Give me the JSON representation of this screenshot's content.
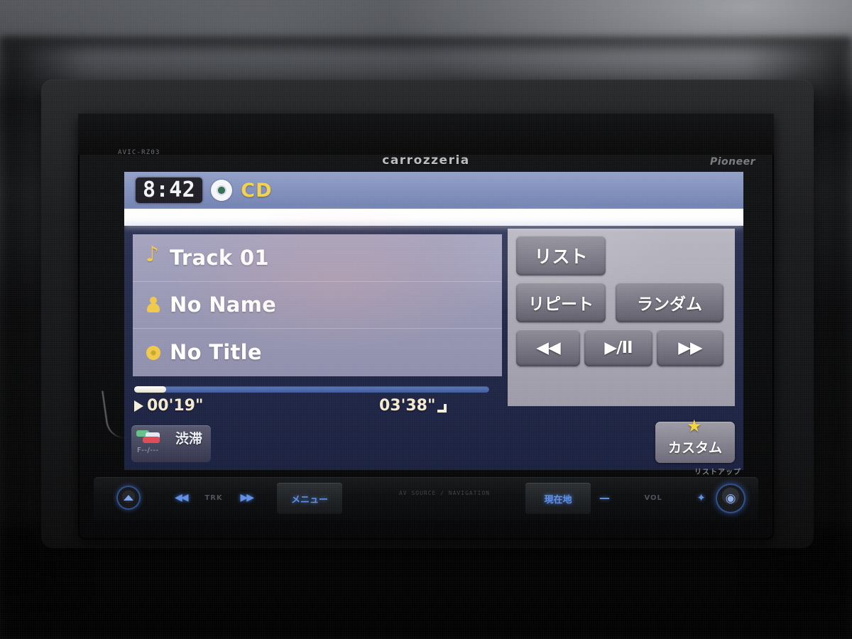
{
  "device": {
    "model_label": "AVIC-RZ03",
    "brand_center": "carrozzeria",
    "brand_right": "Pioneer"
  },
  "screen": {
    "header": {
      "clock": "8:42",
      "disc_icon": "cd-disc-icon",
      "source_label": "CD"
    },
    "now_playing": {
      "rows": [
        {
          "icon": "music-note-icon",
          "text": "Track 01"
        },
        {
          "icon": "artist-person-icon",
          "text": "No Name"
        },
        {
          "icon": "album-disc-icon",
          "text": "No Title"
        }
      ]
    },
    "playback": {
      "state_icon": "play-icon",
      "elapsed": "00'19\"",
      "total": "03'38\"",
      "progress_percent": 9,
      "end_marker_icon": "track-end-icon"
    },
    "traffic_button": {
      "label": "渋滞",
      "icon": "traffic-jam-icon",
      "sub_label": "F--/---"
    },
    "controls": {
      "list": "リスト",
      "repeat": "リピート",
      "random": "ランダム",
      "prev": "◀◀",
      "play_pause": "▶/II",
      "next": "▶▶"
    },
    "custom_button": {
      "label": "カスタム",
      "icon": "star-icon"
    }
  },
  "hardware": {
    "eject_icon": "eject-icon",
    "track_prev_icon": "track-prev-icon",
    "track_next_icon": "track-next-icon",
    "track_label": "TRK",
    "menu_label": "メニュー",
    "current_location_label": "現在地",
    "volume_down": "—",
    "volume_up": "✦",
    "volume_label": "VOL",
    "knob_icon": "power-knob-icon",
    "right_engraving": "リストアップ",
    "center_engraving": "AV SOURCE / NAVIGATION"
  },
  "colors": {
    "accent_yellow": "#f0c84a",
    "header_blue": "#7c8bb9",
    "screen_navy": "#232a48",
    "button_gray": "#757380"
  }
}
